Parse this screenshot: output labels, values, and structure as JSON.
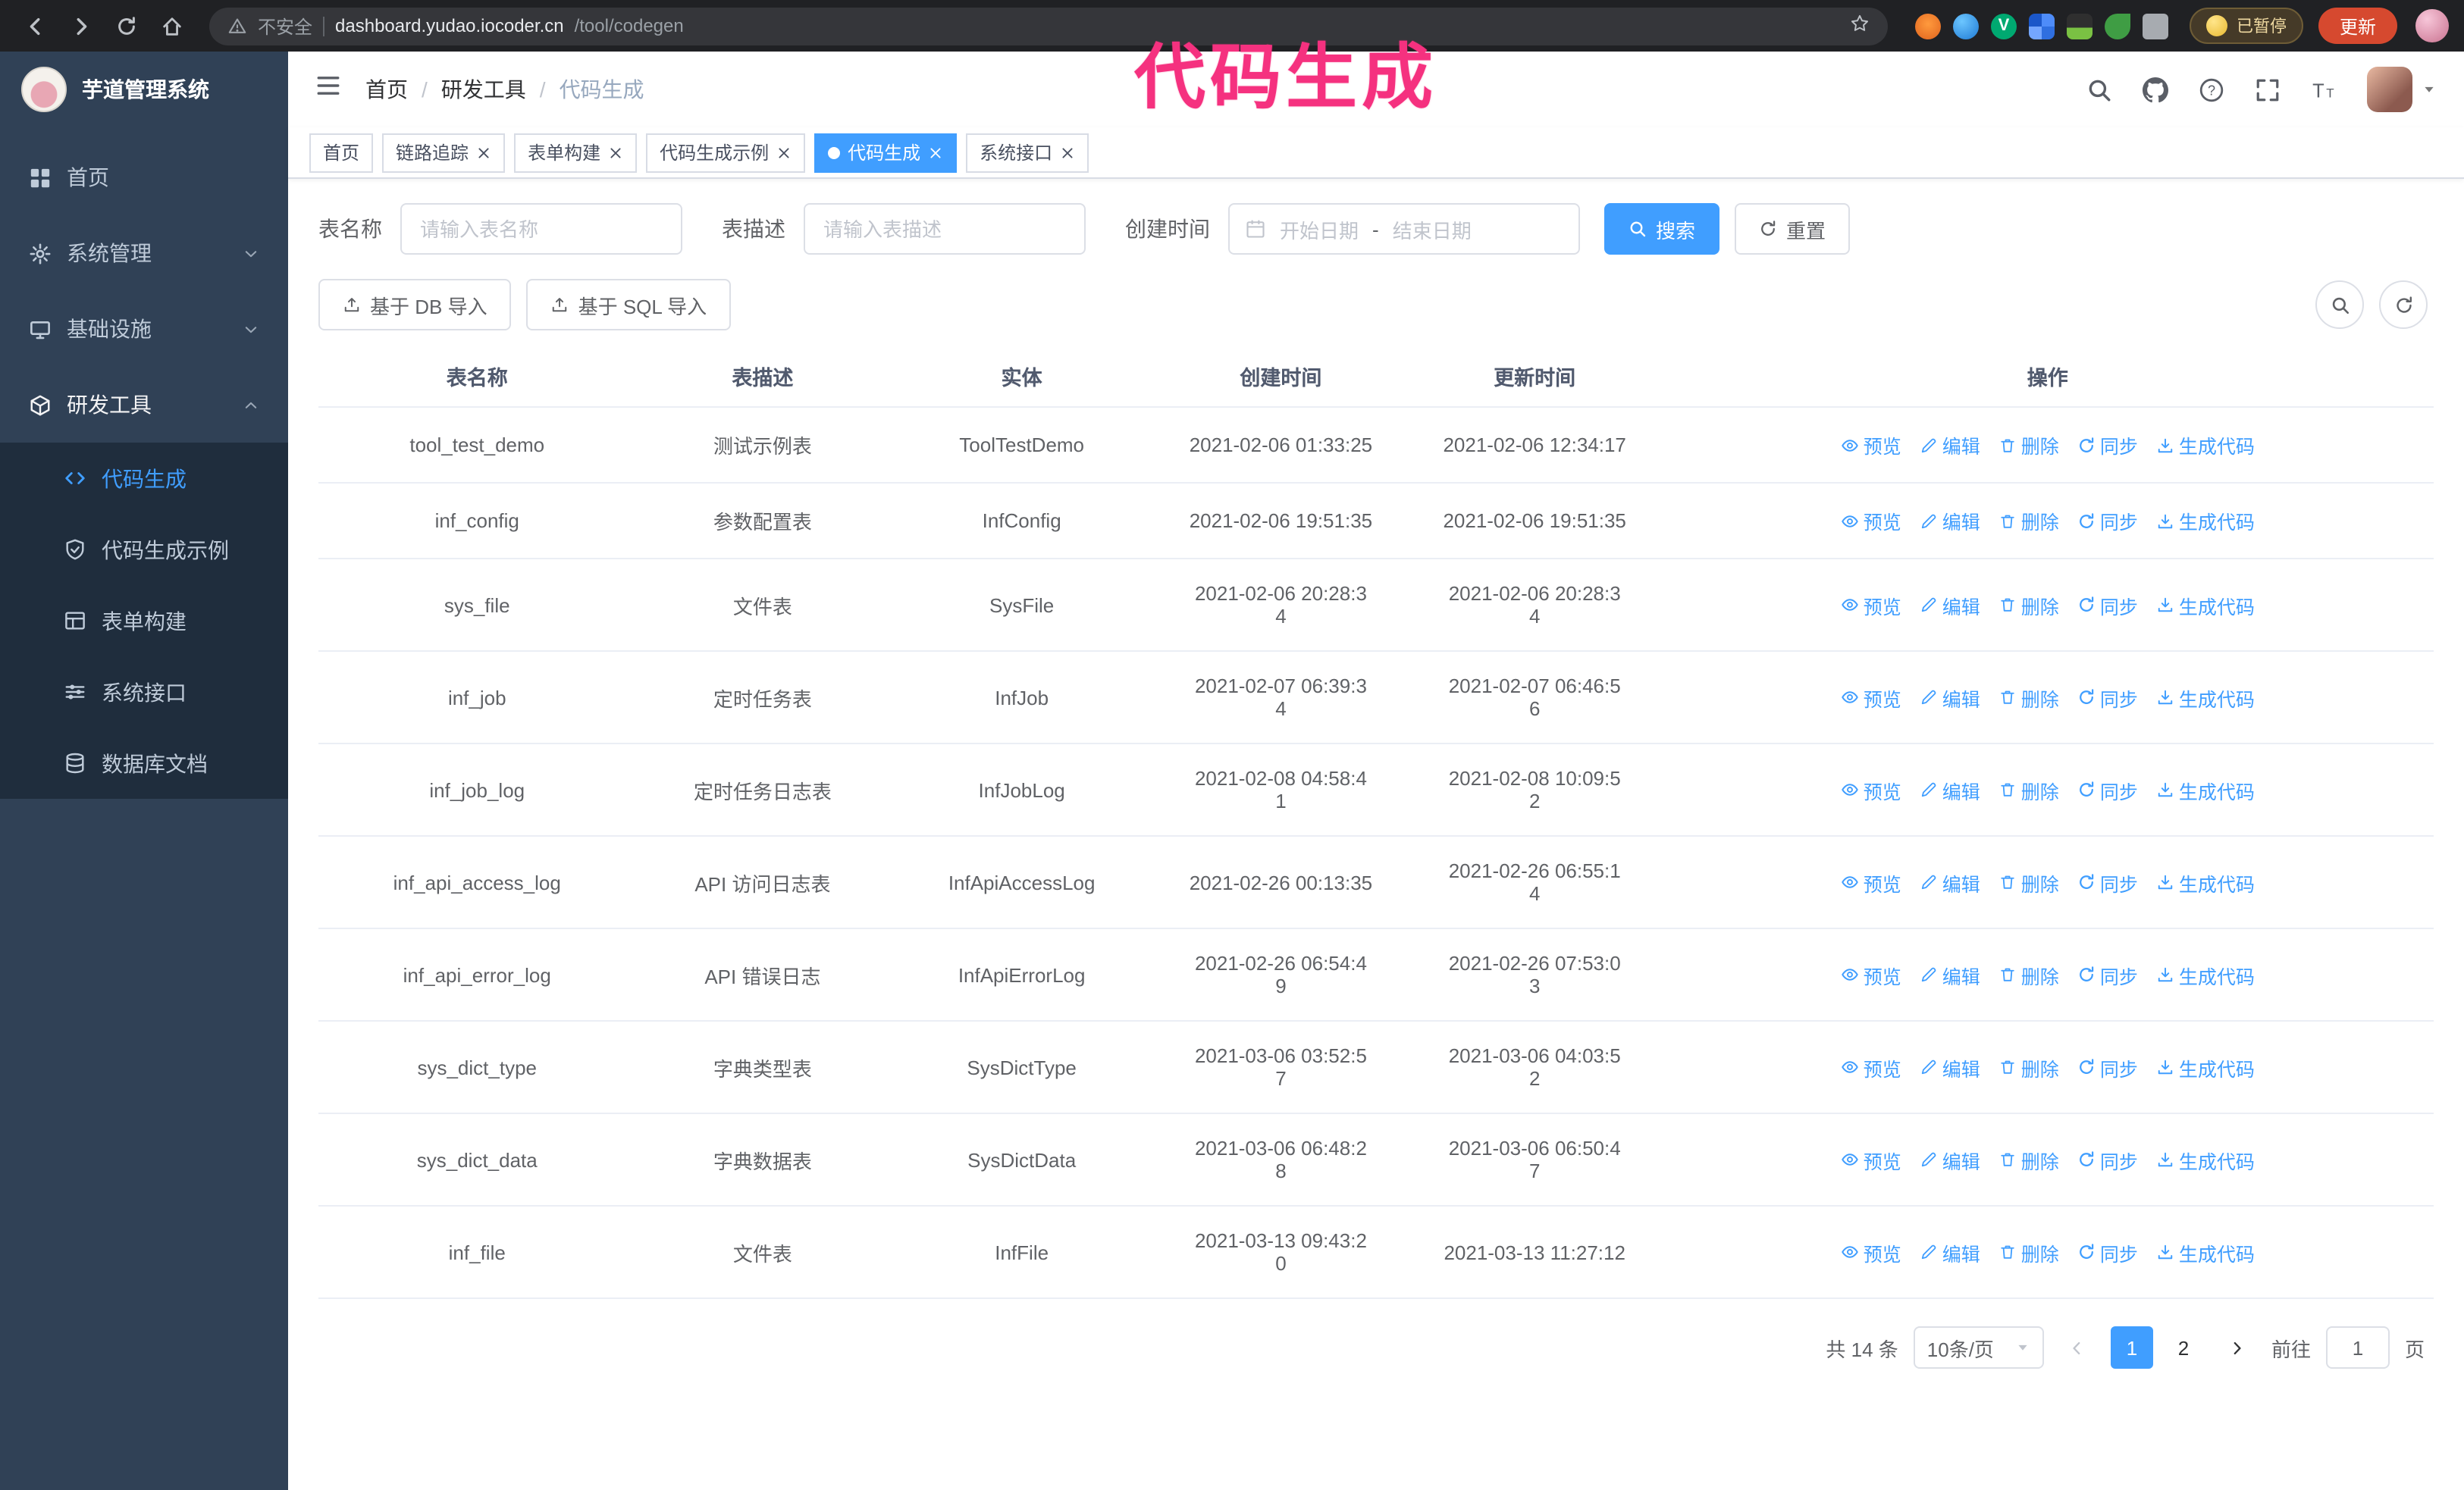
{
  "annotation": {
    "text": "代码生成",
    "color": "#f5317f"
  },
  "browser": {
    "insecure_label": "不安全",
    "url_host": "dashboard.yudao.iocoder.cn",
    "url_path": "/tool/codegen",
    "paused_badge": "已暂停",
    "update_button": "更新",
    "extensions": [
      "fox",
      "drop",
      "check",
      "grid",
      "dark",
      "leaf",
      "puzzle"
    ]
  },
  "sidebar": {
    "logo_title": "芋道管理系统",
    "items": [
      {
        "label": "首页",
        "icon": "dashboard-icon",
        "expandable": false
      },
      {
        "label": "系统管理",
        "icon": "gear-icon",
        "expandable": true
      },
      {
        "label": "基础设施",
        "icon": "infrastructure-icon",
        "expandable": true
      },
      {
        "label": "研发工具",
        "icon": "tools-icon",
        "expandable": true,
        "expanded": true,
        "children": [
          {
            "label": "代码生成",
            "icon": "code-icon",
            "active": true
          },
          {
            "label": "代码生成示例",
            "icon": "example-icon",
            "active": false
          },
          {
            "label": "表单构建",
            "icon": "form-icon",
            "active": false
          },
          {
            "label": "系统接口",
            "icon": "api-icon",
            "active": false
          },
          {
            "label": "数据库文档",
            "icon": "database-icon",
            "active": false
          }
        ]
      }
    ]
  },
  "topbar": {
    "breadcrumb": [
      "首页",
      "研发工具",
      "代码生成"
    ],
    "icons": [
      "search-icon",
      "github-icon",
      "question-icon",
      "fullscreen-icon",
      "fontsize-icon"
    ]
  },
  "tabs": [
    {
      "label": "首页",
      "closable": false,
      "active": false
    },
    {
      "label": "链路追踪",
      "closable": true,
      "active": false
    },
    {
      "label": "表单构建",
      "closable": true,
      "active": false
    },
    {
      "label": "代码生成示例",
      "closable": true,
      "active": false
    },
    {
      "label": "代码生成",
      "closable": true,
      "active": true
    },
    {
      "label": "系统接口",
      "closable": true,
      "active": false
    }
  ],
  "filters": {
    "name_label": "表名称",
    "name_placeholder": "请输入表名称",
    "desc_label": "表描述",
    "desc_placeholder": "请输入表描述",
    "time_label": "创建时间",
    "start_placeholder": "开始日期",
    "range_separator": "-",
    "end_placeholder": "结束日期",
    "search_label": "搜索",
    "reset_label": "重置"
  },
  "toolbar": {
    "import_db_label": "基于 DB 导入",
    "import_sql_label": "基于 SQL 导入"
  },
  "table": {
    "columns": [
      "表名称",
      "表描述",
      "实体",
      "创建时间",
      "更新时间",
      "操作"
    ],
    "actions": [
      {
        "label": "预览",
        "icon": "eye-icon"
      },
      {
        "label": "编辑",
        "icon": "edit-icon"
      },
      {
        "label": "删除",
        "icon": "delete-icon"
      },
      {
        "label": "同步",
        "icon": "sync-icon"
      },
      {
        "label": "生成代码",
        "icon": "download-icon"
      }
    ],
    "rows": [
      {
        "name": "tool_test_demo",
        "desc": "测试示例表",
        "entity": "ToolTestDemo",
        "created": "2021-02-06 01:33:25",
        "updated": "2021-02-06 12:34:17"
      },
      {
        "name": "inf_config",
        "desc": "参数配置表",
        "entity": "InfConfig",
        "created": "2021-02-06 19:51:35",
        "updated": "2021-02-06 19:51:35"
      },
      {
        "name": "sys_file",
        "desc": "文件表",
        "entity": "SysFile",
        "created": "2021-02-06 20:28:3\n4",
        "updated": "2021-02-06 20:28:3\n4"
      },
      {
        "name": "inf_job",
        "desc": "定时任务表",
        "entity": "InfJob",
        "created": "2021-02-07 06:39:3\n4",
        "updated": "2021-02-07 06:46:5\n6"
      },
      {
        "name": "inf_job_log",
        "desc": "定时任务日志表",
        "entity": "InfJobLog",
        "created": "2021-02-08 04:58:4\n1",
        "updated": "2021-02-08 10:09:5\n2"
      },
      {
        "name": "inf_api_access_log",
        "desc": "API 访问日志表",
        "entity": "InfApiAccessLog",
        "created": "2021-02-26 00:13:35",
        "updated": "2021-02-26 06:55:1\n4"
      },
      {
        "name": "inf_api_error_log",
        "desc": "API 错误日志",
        "entity": "InfApiErrorLog",
        "created": "2021-02-26 06:54:4\n9",
        "updated": "2021-02-26 07:53:0\n3"
      },
      {
        "name": "sys_dict_type",
        "desc": "字典类型表",
        "entity": "SysDictType",
        "created": "2021-03-06 03:52:5\n7",
        "updated": "2021-03-06 04:03:5\n2"
      },
      {
        "name": "sys_dict_data",
        "desc": "字典数据表",
        "entity": "SysDictData",
        "created": "2021-03-06 06:48:2\n8",
        "updated": "2021-03-06 06:50:4\n7"
      },
      {
        "name": "inf_file",
        "desc": "文件表",
        "entity": "InfFile",
        "created": "2021-03-13 09:43:2\n0",
        "updated": "2021-03-13 11:27:12"
      }
    ]
  },
  "pagination": {
    "total_text": "共 14 条",
    "page_size_text": "10条/页",
    "pages": [
      "1",
      "2"
    ],
    "active_page": "1",
    "goto_label": "前往",
    "goto_value": "1",
    "goto_unit": "页"
  },
  "colors": {
    "primary": "#409eff",
    "sidebar_bg": "#304156",
    "submenu_bg": "#1f2d3d",
    "annotation": "#f5317f",
    "update_button": "#d6492f"
  }
}
